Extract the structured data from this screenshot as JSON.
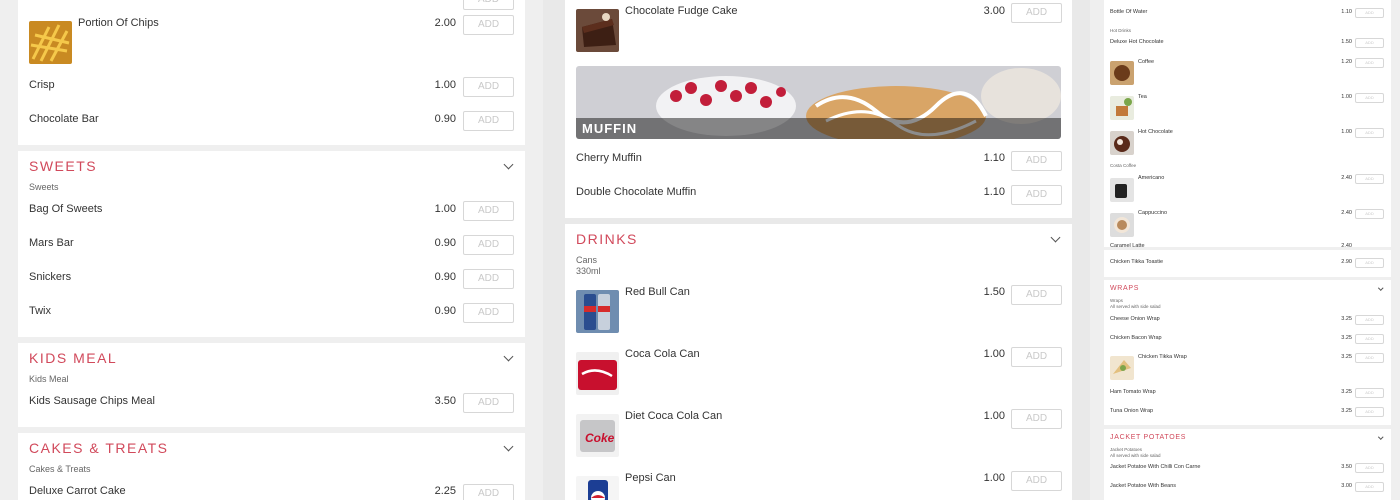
{
  "add_label": "ADD",
  "colors": {
    "accent": "#d1495b",
    "bg": "#efefef"
  },
  "left": {
    "portion_chips": {
      "name": "Portion Of Chips",
      "price": "2.00"
    },
    "crisp": {
      "name": "Crisp",
      "price": "1.00"
    },
    "choc_bar": {
      "name": "Chocolate Bar",
      "price": "0.90"
    },
    "sweets": {
      "title": "SWEETS",
      "sub": "Sweets",
      "items": [
        {
          "name": "Bag Of Sweets",
          "price": "1.00"
        },
        {
          "name": "Mars Bar",
          "price": "0.90"
        },
        {
          "name": "Snickers",
          "price": "0.90"
        },
        {
          "name": "Twix",
          "price": "0.90"
        }
      ]
    },
    "kids": {
      "title": "KIDS MEAL",
      "sub": "Kids Meal",
      "item": {
        "name": "Kids Sausage Chips Meal",
        "price": "3.50"
      }
    },
    "cakes": {
      "title": "CAKES & TREATS",
      "sub": "Cakes & Treats",
      "item": {
        "name": "Deluxe Carrot Cake",
        "price": "2.25"
      }
    }
  },
  "middle": {
    "fudge": {
      "name": "Chocolate Fudge Cake",
      "price": "3.00"
    },
    "muffin_banner": "MUFFIN",
    "cherry": {
      "name": "Cherry Muffin",
      "price": "1.10"
    },
    "double": {
      "name": "Double Chocolate Muffin",
      "price": "1.10"
    },
    "drinks": {
      "title": "DRINKS",
      "sub1": "Cans",
      "sub2": "330ml",
      "items": [
        {
          "name": "Red Bull Can",
          "price": "1.50"
        },
        {
          "name": "Coca Cola Can",
          "price": "1.00"
        },
        {
          "name": "Diet Coca Cola Can",
          "price": "1.00"
        },
        {
          "name": "Pepsi Can",
          "price": "1.00"
        }
      ]
    }
  },
  "right": {
    "water": {
      "name": "Bottle Of Water",
      "price": "1.10"
    },
    "hot_sub": "Hot Drinks",
    "deluxe_hot": {
      "name": "Deluxe Hot Chocolate",
      "price": "1.50"
    },
    "coffee": {
      "name": "Coffee",
      "price": "1.20"
    },
    "tea": {
      "name": "Tea",
      "price": "1.00"
    },
    "hot_choc": {
      "name": "Hot Chocolate",
      "price": "1.00"
    },
    "costa_sub": "Costa Coffee",
    "americano": {
      "name": "Americano",
      "price": "2.40"
    },
    "cappuccino": {
      "name": "Cappuccino",
      "price": "2.40"
    },
    "caramel": {
      "name": "Caramel Latte",
      "price": "2.40"
    },
    "tikka_toastie": {
      "name": "Chicken Tikka Toastie",
      "price": "2.90"
    },
    "wraps": {
      "title": "WRAPS",
      "sub1": "Wraps",
      "sub2": "All served with side salad",
      "items": [
        {
          "name": "Cheese Onion Wrap",
          "price": "3.25"
        },
        {
          "name": "Chicken Bacon Wrap",
          "price": "3.25"
        },
        {
          "name": "Chicken Tikka Wrap",
          "price": "3.25"
        },
        {
          "name": "Ham Tomato Wrap",
          "price": "3.25"
        },
        {
          "name": "Tuna Onion Wrap",
          "price": "3.25"
        }
      ]
    },
    "potatoes": {
      "title": "JACKET POTATOES",
      "sub1": "Jacket Potatoes",
      "sub2": "All served with side salad",
      "items": [
        {
          "name": "Jacket Potatoe With Chilli Con Carne",
          "price": "3.50"
        },
        {
          "name": "Jacket Potatoe With Beans",
          "price": "3.00"
        }
      ]
    }
  }
}
